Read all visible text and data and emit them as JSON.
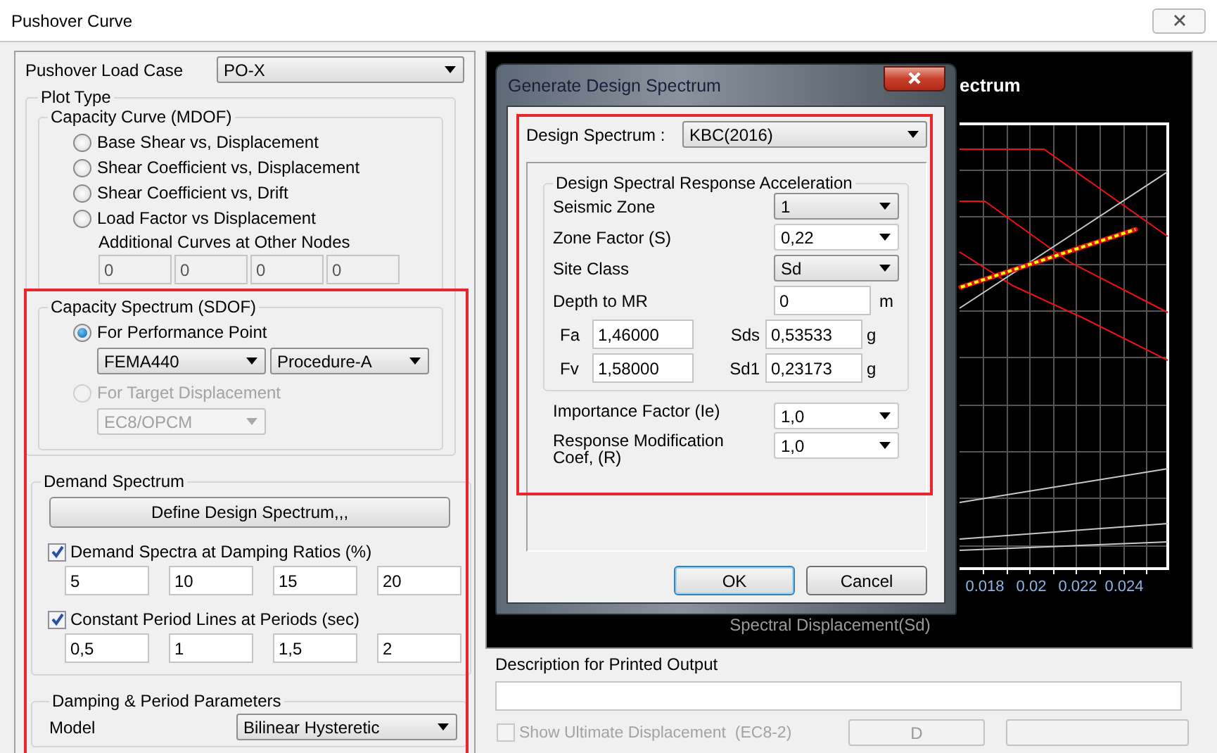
{
  "window": {
    "title": "Pushover Curve"
  },
  "load_case": {
    "label": "Pushover Load Case",
    "value": "PO-X"
  },
  "plot_type": {
    "title": "Plot Type",
    "capacity_curve": {
      "title": "Capacity Curve (MDOF)",
      "options": [
        {
          "label": "Base Shear vs, Displacement",
          "selected": false
        },
        {
          "label": "Shear Coefficient vs, Displacement",
          "selected": false
        },
        {
          "label": "Shear Coefficient vs, Drift",
          "selected": false
        },
        {
          "label": "Load Factor vs Displacement",
          "selected": false
        }
      ],
      "additional_label": "Additional Curves at Other Nodes",
      "additional_nodes": [
        {
          "value": "0",
          "disabled": true
        },
        {
          "value": "0",
          "disabled": true
        },
        {
          "value": "0",
          "disabled": true
        },
        {
          "value": "0",
          "disabled": true
        }
      ]
    },
    "capacity_spectrum": {
      "title": "Capacity Spectrum (SDOF)",
      "options": [
        {
          "label": "For Performance Point",
          "selected": true,
          "disabled": false,
          "selects": [
            {
              "value": "FEMA440",
              "disabled": false
            },
            {
              "value": "Procedure-A",
              "disabled": false
            }
          ]
        },
        {
          "label": "For Target Displacement",
          "selected": false,
          "disabled": true,
          "selects": [
            {
              "value": "EC8/OPCM",
              "disabled": true
            }
          ]
        }
      ]
    }
  },
  "demand_spectrum": {
    "title": "Demand Spectrum",
    "button": "Define Design Spectrum,,,",
    "groups": [
      {
        "label": "Demand Spectra at Damping Ratios (%)",
        "checked": true,
        "values": [
          "5",
          "10",
          "15",
          "20"
        ]
      },
      {
        "label": "Constant Period Lines at Periods (sec)",
        "checked": true,
        "values": [
          "0,5",
          "1",
          "1,5",
          "2"
        ]
      }
    ]
  },
  "damping": {
    "title": "Damping & Period Parameters",
    "model_label": "Model",
    "model": "Bilinear Hysteretic"
  },
  "chart": {
    "title": "ectrum",
    "x_ticks": [
      "0.018",
      "0.02",
      "0.022",
      "0.024"
    ],
    "xlabel": "Spectral Displacement(Sd)"
  },
  "description": {
    "label": "Description for Printed Output"
  },
  "show_ultimate": {
    "label": "Show Ultimate Displacement  (EC8-2)",
    "checked": false,
    "disabled": true
  },
  "bottom_buttons": [
    {
      "label": "D",
      "disabled": true
    },
    {
      "disabled": true
    }
  ],
  "dialog": {
    "title": "Generate Design Spectrum",
    "spectrum_label": "Design Spectrum :",
    "spectrum": "KBC(2016)",
    "group_title": "Design Spectral Response Acceleration",
    "rows": [
      {
        "kind": "select",
        "label": "Seismic Zone",
        "value": "1"
      },
      {
        "kind": "combo",
        "label": "Zone Factor (S)",
        "value": "0,22"
      },
      {
        "kind": "select",
        "label": "Site Class",
        "value": "Sd"
      },
      {
        "kind": "input",
        "label": "Depth to MR",
        "value": "0",
        "unit": "m"
      }
    ],
    "coefficients": [
      {
        "label": "Fa",
        "value": "1,46000",
        "result_label": "Sds",
        "result": "0,53533",
        "unit": "g"
      },
      {
        "label": "Fv",
        "value": "1,58000",
        "result_label": "Sd1",
        "result": "0,23173",
        "unit": "g"
      }
    ],
    "factors": [
      {
        "label": "Importance Factor (Ie)",
        "value": "1,0"
      },
      {
        "label": "Response Modification Coef, (R)",
        "value": "1,0"
      }
    ],
    "buttons": [
      {
        "label": "OK",
        "default": true
      },
      {
        "label": "Cancel",
        "default": false
      }
    ]
  }
}
